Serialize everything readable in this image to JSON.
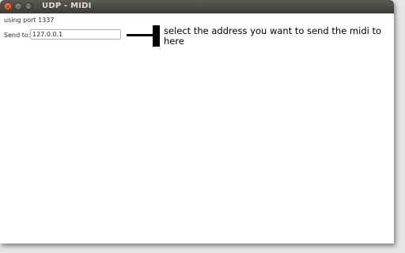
{
  "window": {
    "title": "UDP - MIDI",
    "close_glyph": "×",
    "minimize_glyph": "–",
    "maximize_glyph": "□"
  },
  "status": {
    "port_text": "using port 1337"
  },
  "send": {
    "label": "Send to:",
    "address_value": "127.0.0.1"
  },
  "annotation": {
    "text": "select the address you want to send the midi to here"
  },
  "colors": {
    "titlebar": "#3c3b37",
    "close_button": "#de4a12",
    "window_background": "#ffffff"
  }
}
